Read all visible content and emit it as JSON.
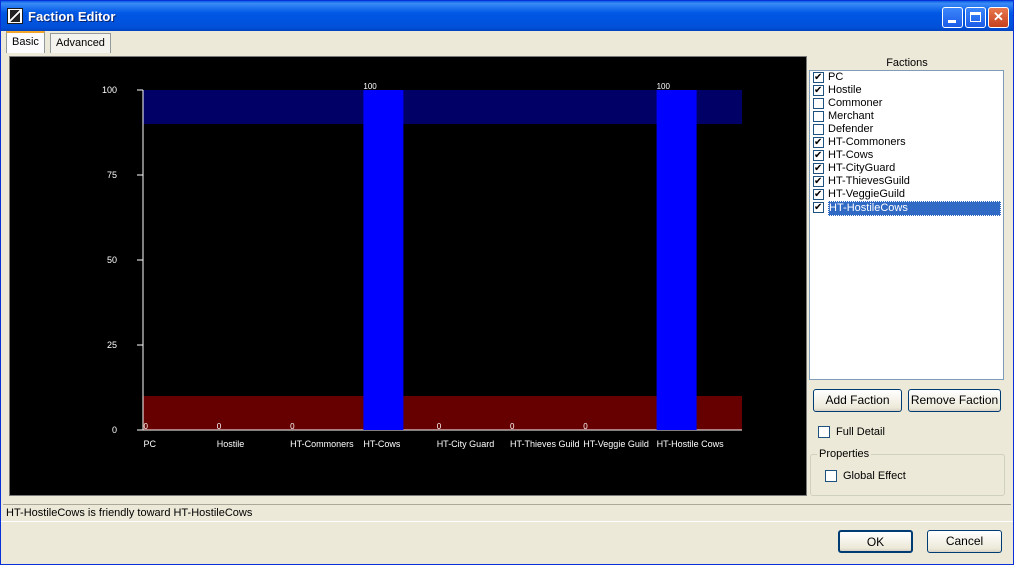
{
  "window": {
    "title": "Faction Editor"
  },
  "tabs": [
    {
      "label": "Basic",
      "active": true
    },
    {
      "label": "Advanced",
      "active": false
    }
  ],
  "chart_data": {
    "type": "bar",
    "categories": [
      "PC",
      "Hostile",
      "HT-Commoners",
      "HT-Cows",
      "HT-City Guard",
      "HT-Thieves Guild",
      "HT-Veggie Guild",
      "HT-Hostile Cows"
    ],
    "values": [
      0,
      0,
      0,
      100,
      0,
      0,
      0,
      100
    ],
    "value_labels": [
      "0",
      "0",
      "0",
      "100",
      "0",
      "0",
      "0",
      "100"
    ],
    "ylim": [
      0,
      100
    ],
    "yticks": [
      0,
      25,
      50,
      75,
      100
    ],
    "ytick_labels": [
      "0",
      "25",
      "50",
      "75",
      "100"
    ],
    "bands": [
      {
        "name": "hostile-band",
        "from": 0,
        "to": 10,
        "color": "#660000"
      },
      {
        "name": "friendly-band",
        "from": 90,
        "to": 100,
        "color": "#000066"
      }
    ],
    "bar_color": "#0000ff",
    "background": "#000000",
    "text_color": "#ffffff"
  },
  "factions_panel": {
    "title": "Factions",
    "items": [
      {
        "label": "PC",
        "checked": true,
        "selected": false
      },
      {
        "label": "Hostile",
        "checked": true,
        "selected": false
      },
      {
        "label": "Commoner",
        "checked": false,
        "selected": false
      },
      {
        "label": "Merchant",
        "checked": false,
        "selected": false
      },
      {
        "label": "Defender",
        "checked": false,
        "selected": false
      },
      {
        "label": "HT-Commoners",
        "checked": true,
        "selected": false
      },
      {
        "label": "HT-Cows",
        "checked": true,
        "selected": false
      },
      {
        "label": "HT-CityGuard",
        "checked": true,
        "selected": false
      },
      {
        "label": "HT-ThievesGuild",
        "checked": true,
        "selected": false
      },
      {
        "label": "HT-VeggieGuild",
        "checked": true,
        "selected": false
      },
      {
        "label": "HT-HostileCows",
        "checked": true,
        "selected": true
      }
    ],
    "add_label": "Add Faction",
    "remove_label": "Remove Faction",
    "full_detail_label": "Full Detail",
    "full_detail_checked": false,
    "properties_title": "Properties",
    "global_effect_label": "Global Effect",
    "global_effect_checked": false
  },
  "status": {
    "text": "HT-HostileCows is friendly toward HT-HostileCows"
  },
  "buttons": {
    "ok": "OK",
    "cancel": "Cancel"
  }
}
